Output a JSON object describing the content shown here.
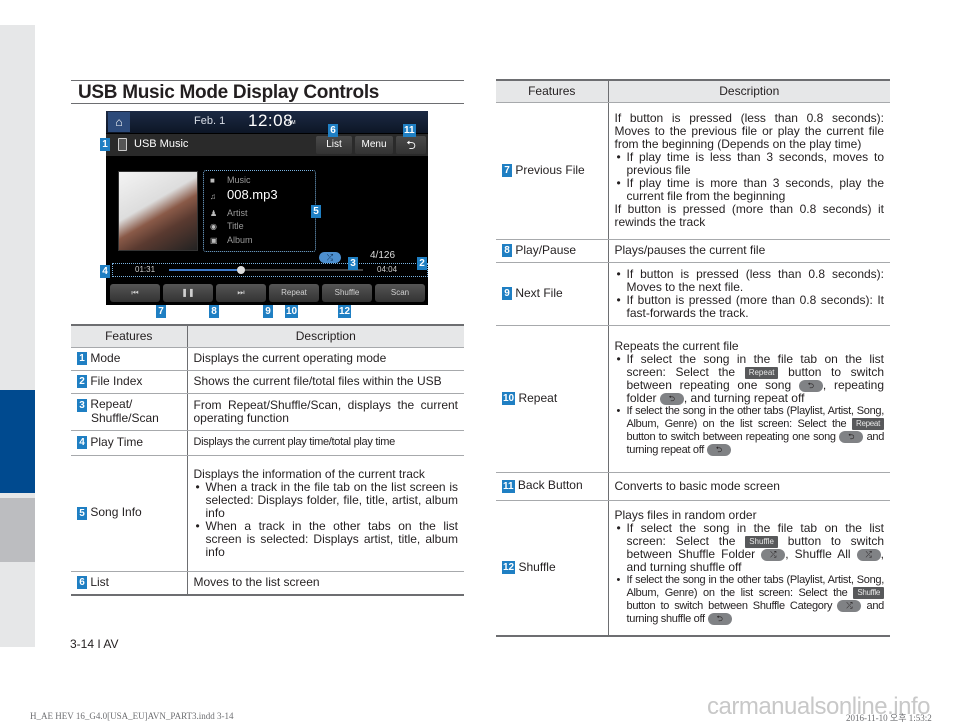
{
  "page": {
    "title": "USB Music Mode Display Controls",
    "page_number": "3-14 I AV",
    "footer_file": "H_AE HEV 16_G4.0[USA_EU]AVN_PART3.indd   3-14",
    "footer_date": "2016-11-10   오후 1:53:2",
    "watermark": "carmanualsonline.info"
  },
  "screen": {
    "date": "Feb.  1",
    "time": "12:08",
    "ampm": "AM",
    "mode": "USB Music",
    "buttons": {
      "list": "List",
      "menu": "Menu",
      "back": "⮌"
    },
    "song": {
      "folder": "Music",
      "file": "008.mp3",
      "artist": "Artist",
      "title": "Title",
      "album": "Album"
    },
    "shuffle_indicator": "⤮",
    "file_index": "4/126",
    "elapsed": "01:31",
    "total": "04:04",
    "progress": 0.37,
    "controls": [
      "⏮",
      "❚❚",
      "⏭",
      "Repeat",
      "Shuffle",
      "Scan"
    ],
    "callouts": [
      "1",
      "2",
      "3",
      "4",
      "5",
      "6",
      "7",
      "8",
      "9",
      "10",
      "11",
      "12"
    ]
  },
  "left_table": {
    "headers": [
      "Features",
      "Description"
    ],
    "rows": [
      {
        "num": "1",
        "feature": "Mode",
        "desc": "Displays the current operating mode"
      },
      {
        "num": "2",
        "feature": "File Index",
        "desc": "Shows the current file/total files within the USB"
      },
      {
        "num": "3",
        "feature": "Repeat/",
        "feature2": "Shuffle/Scan",
        "desc": "From Repeat/Shuffle/Scan, displays the current operating function"
      },
      {
        "num": "4",
        "feature": "Play Time",
        "desc": "Displays the current play time/total play time"
      },
      {
        "num": "5",
        "feature": "Song Info",
        "desc": "Displays the information of the current track",
        "bullets": [
          "When a track in the file tab on the list screen is selected: Displays folder, file, title, artist, album info",
          "When a track in the other tabs on the list screen is selected: Displays artist, title, album info"
        ]
      },
      {
        "num": "6",
        "feature": "List",
        "desc": "Moves to the list screen"
      }
    ]
  },
  "right_table": {
    "headers": [
      "Features",
      "Description"
    ],
    "rows": [
      {
        "num": "7",
        "feature": "Previous File",
        "desc": "If button is pressed (less than 0.8 seconds): Moves to the previous file or play the current file from the beginning (Depends on the play time)",
        "bullets": [
          "If play time is less than 3 seconds, moves to previous file",
          "If play time is more than 3 seconds, play the current file from the beginning"
        ],
        "desc_after": "If button is pressed (more than 0.8 seconds) it rewinds the track"
      },
      {
        "num": "8",
        "feature": "Play/Pause",
        "desc": "Plays/pauses the current file"
      },
      {
        "num": "9",
        "feature": "Next File",
        "bullets": [
          "If button is pressed (less than 0.8 seconds): Moves to the next file.",
          "If button is pressed (more than 0.8 seconds): It fast-forwards the track."
        ]
      },
      {
        "num": "10",
        "feature": "Repeat",
        "desc": "Repeats the current file",
        "b1": {
          "a": "If select the song in the file tab on the list screen: Select the",
          "btn": "Repeat",
          "b": "button to switch between repeating one song",
          "c": ", repeating folder",
          "d": ", and turning repeat off"
        },
        "b2": {
          "a": "If select the song in the other tabs (Playlist, Artist, Song, Album, Genre) on the list screen: Select the",
          "btn": "Repeat",
          "b": "button to switch between repeating one song",
          "c": "and turning repeat off"
        }
      },
      {
        "num": "11",
        "feature": "Back Button",
        "desc": "Converts to basic mode screen"
      },
      {
        "num": "12",
        "feature": "Shuffle",
        "desc": "Plays files in random order",
        "b1": {
          "a": "If select the song in the file tab on the list screen: Select the",
          "btn": "Shuffle",
          "b": "button to switch between Shuffle Folder",
          "c": ", Shuffle All",
          "d": ", and turning shuffle off"
        },
        "b2": {
          "a": "If select the song in the other tabs (Playlist, Artist, Song, Album, Genre) on the list screen: Select the",
          "btn": "Shuffle",
          "b": "button to switch between Shuffle Category",
          "c": "and turning shuffle off"
        }
      }
    ]
  },
  "icons": {
    "repeat_one": "⮌",
    "repeat_folder": "⮌",
    "repeat_off": "⮌",
    "shuffle_folder": "⤮",
    "shuffle_all": "⤮"
  },
  "colors": {
    "accent_blue": "#1f7fc3",
    "sidebar_blue": "#004a8f",
    "header_gray": "#e6e7e8"
  }
}
